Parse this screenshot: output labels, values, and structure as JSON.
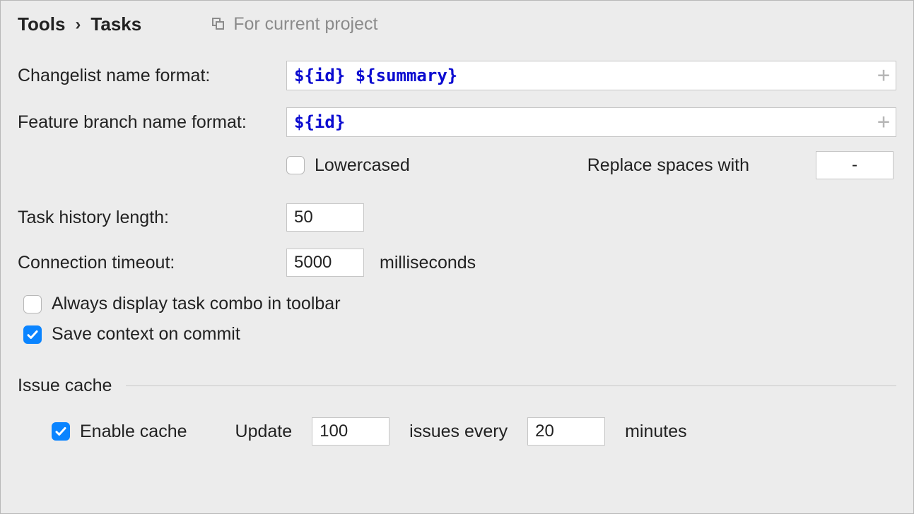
{
  "breadcrumb": {
    "parent": "Tools",
    "current": "Tasks"
  },
  "scope_label": "For current project",
  "labels": {
    "changelist_format": "Changelist name format:",
    "branch_format": "Feature branch name format:",
    "lowercased": "Lowercased",
    "replace_spaces": "Replace spaces with",
    "task_history": "Task history length:",
    "conn_timeout": "Connection timeout:",
    "ms": "milliseconds",
    "always_combo": "Always display task combo in toolbar",
    "save_context": "Save context on commit",
    "issue_cache": "Issue cache",
    "enable_cache": "Enable cache",
    "update_prefix": "Update",
    "issues_every": "issues every",
    "minutes": "minutes"
  },
  "values": {
    "changelist_literal": "${id} ${summary}",
    "changelist_parts": [
      {
        "t": "dollar",
        "v": "$"
      },
      {
        "t": "brace",
        "v": "{"
      },
      {
        "t": "var",
        "v": "id"
      },
      {
        "t": "brace",
        "v": "}"
      },
      {
        "t": "plain",
        "v": " "
      },
      {
        "t": "dollar",
        "v": "$"
      },
      {
        "t": "brace",
        "v": "{"
      },
      {
        "t": "var",
        "v": "summary"
      },
      {
        "t": "brace",
        "v": "}"
      }
    ],
    "branch_literal": "${id}",
    "branch_parts": [
      {
        "t": "dollar",
        "v": "$"
      },
      {
        "t": "brace",
        "v": "{"
      },
      {
        "t": "var",
        "v": "id"
      },
      {
        "t": "brace",
        "v": "}"
      }
    ],
    "lowercased_checked": false,
    "replace_spaces_with": "-",
    "task_history_length": "50",
    "connection_timeout": "5000",
    "always_combo_checked": false,
    "save_context_checked": true,
    "enable_cache_checked": true,
    "cache_count": "100",
    "cache_minutes": "20"
  }
}
